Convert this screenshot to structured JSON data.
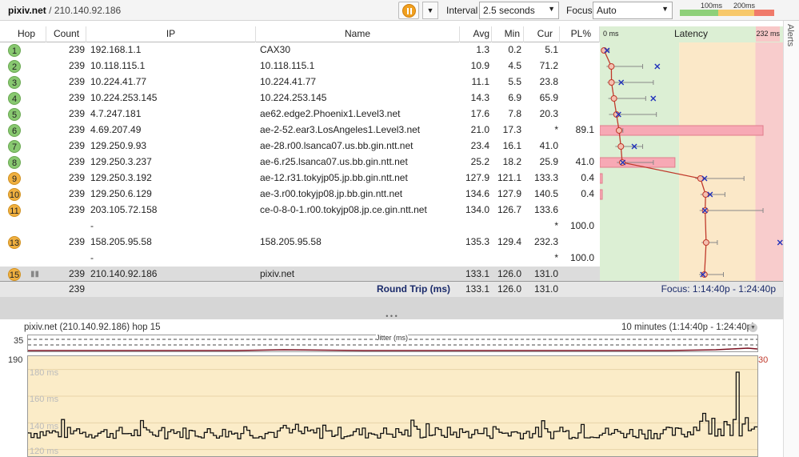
{
  "header": {
    "host_name": "pixiv.net",
    "host_sep": " / ",
    "host_ip": "210.140.92.186",
    "interval_label": "Interval",
    "interval_value": "2.5 seconds",
    "focus_label": "Focus",
    "focus_value": "Auto",
    "legend_100": "100ms",
    "legend_200": "200ms"
  },
  "alerts_label": "Alerts",
  "columns": {
    "hop": "Hop",
    "count": "Count",
    "ip": "IP",
    "name": "Name",
    "avg": "Avg",
    "min": "Min",
    "cur": "Cur",
    "pl": "PL%",
    "latency_start": "0 ms",
    "latency": "Latency",
    "latency_end": "232 ms"
  },
  "hops": [
    {
      "hop": "1",
      "count": "239",
      "ip": "192.168.1.1",
      "name": "CAX30",
      "avg": "1.3",
      "min": "0.2",
      "cur": "5.1",
      "pl": "",
      "color": "g",
      "avgv": 1.3,
      "minv": 0.2,
      "maxv": 8,
      "curv": 5.1,
      "plv": 0
    },
    {
      "hop": "2",
      "count": "239",
      "ip": "10.118.115.1",
      "name": "10.118.115.1",
      "avg": "10.9",
      "min": "4.5",
      "cur": "71.2",
      "pl": "",
      "color": "g",
      "avgv": 10.9,
      "minv": 4.5,
      "maxv": 52,
      "curv": 71.2,
      "plv": 0
    },
    {
      "hop": "3",
      "count": "239",
      "ip": "10.224.41.77",
      "name": "10.224.41.77",
      "avg": "11.1",
      "min": "5.5",
      "cur": "23.8",
      "pl": "",
      "color": "g",
      "avgv": 11.1,
      "minv": 5.5,
      "maxv": 66,
      "curv": 23.8,
      "plv": 0
    },
    {
      "hop": "4",
      "count": "239",
      "ip": "10.224.253.145",
      "name": "10.224.253.145",
      "avg": "14.3",
      "min": "6.9",
      "cur": "65.9",
      "pl": "",
      "color": "g",
      "avgv": 14.3,
      "minv": 6.9,
      "maxv": 56,
      "curv": 65.9,
      "plv": 0
    },
    {
      "hop": "5",
      "count": "239",
      "ip": "4.7.247.181",
      "name": "ae62.edge2.Phoenix1.Level3.net",
      "avg": "17.6",
      "min": "7.8",
      "cur": "20.3",
      "pl": "",
      "color": "g",
      "avgv": 17.6,
      "minv": 7.8,
      "maxv": 70,
      "curv": 20.3,
      "plv": 0
    },
    {
      "hop": "6",
      "count": "239",
      "ip": "4.69.207.49",
      "name": "ae-2-52.ear3.LosAngeles1.Level3.net",
      "avg": "21.0",
      "min": "17.3",
      "cur": "*",
      "pl": "89.1",
      "color": "g",
      "avgv": 21.0,
      "minv": 17.3,
      "maxv": 26,
      "curv": null,
      "plv": 89.1
    },
    {
      "hop": "7",
      "count": "239",
      "ip": "129.250.9.93",
      "name": "ae-28.r00.lsanca07.us.bb.gin.ntt.net",
      "avg": "23.4",
      "min": "16.1",
      "cur": "41.0",
      "pl": "",
      "color": "g",
      "avgv": 23.4,
      "minv": 16.1,
      "maxv": 52,
      "curv": 41.0,
      "plv": 0
    },
    {
      "hop": "8",
      "count": "239",
      "ip": "129.250.3.237",
      "name": "ae-6.r25.lsanca07.us.bb.gin.ntt.net",
      "avg": "25.2",
      "min": "18.2",
      "cur": "25.9",
      "pl": "41.0",
      "color": "g",
      "avgv": 25.2,
      "minv": 18.2,
      "maxv": 66,
      "curv": 25.9,
      "plv": 41.0
    },
    {
      "hop": "9",
      "count": "239",
      "ip": "129.250.3.192",
      "name": "ae-12.r31.tokyjp05.jp.bb.gin.ntt.net",
      "avg": "127.9",
      "min": "121.1",
      "cur": "133.3",
      "pl": "0.4",
      "color": "o",
      "avgv": 127.9,
      "minv": 121.1,
      "maxv": 185,
      "curv": 133.3,
      "plv": 0.4
    },
    {
      "hop": "10",
      "count": "239",
      "ip": "129.250.6.129",
      "name": "ae-3.r00.tokyjp08.jp.bb.gin.ntt.net",
      "avg": "134.6",
      "min": "127.9",
      "cur": "140.5",
      "pl": "0.4",
      "color": "o",
      "avgv": 134.6,
      "minv": 127.9,
      "maxv": 160,
      "curv": 140.5,
      "plv": 0.4
    },
    {
      "hop": "11",
      "count": "239",
      "ip": "203.105.72.158",
      "name": "ce-0-8-0-1.r00.tokyjp08.jp.ce.gin.ntt.net",
      "avg": "134.0",
      "min": "126.7",
      "cur": "133.6",
      "pl": "",
      "color": "o",
      "avgv": 134.0,
      "minv": 126.7,
      "maxv": 210,
      "curv": 133.6,
      "plv": 0
    },
    {
      "hop": "",
      "count": "",
      "ip": "-",
      "name": "",
      "avg": "",
      "min": "",
      "cur": "*",
      "pl": "100.0",
      "color": "",
      "avgv": null,
      "plv": 0
    },
    {
      "hop": "13",
      "count": "239",
      "ip": "158.205.95.58",
      "name": "158.205.95.58",
      "avg": "135.3",
      "min": "129.4",
      "cur": "232.3",
      "pl": "",
      "color": "o",
      "avgv": 135.3,
      "minv": 129.4,
      "maxv": 150,
      "curv": 232.3,
      "plv": 0
    },
    {
      "hop": "",
      "count": "",
      "ip": "-",
      "name": "",
      "avg": "",
      "min": "",
      "cur": "*",
      "pl": "100.0",
      "color": "",
      "avgv": null,
      "plv": 0
    },
    {
      "hop": "15",
      "count": "239",
      "ip": "210.140.92.186",
      "name": "pixiv.net",
      "avg": "133.1",
      "min": "126.0",
      "cur": "131.0",
      "pl": "",
      "color": "o",
      "avgv": 133.1,
      "minv": 126.0,
      "maxv": 158,
      "curv": 131.0,
      "plv": 0
    }
  ],
  "summary": {
    "count": "239",
    "label": "Round Trip (ms)",
    "avg": "133.1",
    "min": "126.0",
    "cur": "131.0",
    "focus_range": "Focus: 1:14:40p - 1:24:40p"
  },
  "lower": {
    "title": "pixiv.net (210.140.92.186) hop 15",
    "range": "10 minutes (1:14:40p - 1:24:40p)",
    "jitter_label": "Jitter (ms)",
    "jitter_max": "35",
    "y_max": "190",
    "y_right": "30",
    "grid_labels": [
      "180 ms",
      "160 ms",
      "140 ms",
      "120 ms"
    ]
  },
  "colors": {
    "good": "#88c870",
    "warn": "#f0b040",
    "bad": "#f07a6a",
    "pl_fill": "#f7a9b5",
    "trace": "#c0392b"
  }
}
